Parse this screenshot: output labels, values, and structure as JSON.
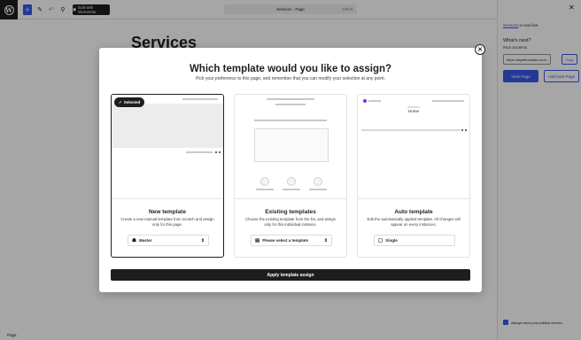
{
  "editor": {
    "elementor_button": "Edit with Elementor",
    "document_title": "Services · Page",
    "shortcut": "Ctrl+K",
    "canvas_title": "Services",
    "footer_crumb": "Page"
  },
  "sidebar": {
    "published_link": "Services",
    "published_suffix": " is now live.",
    "whats_next": "What's next?",
    "address_label": "Page address",
    "address_value": "https://stylefinedsite.com/...",
    "copy_label": "Copy",
    "view_page": "View Page",
    "add_new_page": "Add New Page",
    "checkbox_label": "Always show pre-publish checks."
  },
  "modal": {
    "title": "Which template would you like to assign?",
    "subtitle": "Pick your preference to this page, and remember that you can modify your selection at any point.",
    "cards": [
      {
        "name": "New template",
        "description": "Create a new manual template from scratch and assign only for this page.",
        "select_value": "Master",
        "selected": true,
        "badge": "Selected"
      },
      {
        "name": "Existing templates",
        "description": "Choose the existing template from the list, and assign only for this individual instance.",
        "select_value": "Please select a template",
        "selected": false
      },
      {
        "name": "Auto template",
        "description": "Edit the automatically applied template. All changes will appear on every instances.",
        "select_value": "Single",
        "selected": false,
        "preview_heading": "Home"
      }
    ],
    "apply_button": "Apply template assign"
  },
  "colors": {
    "accent": "#3858e9",
    "dark": "#1e1e1e"
  }
}
